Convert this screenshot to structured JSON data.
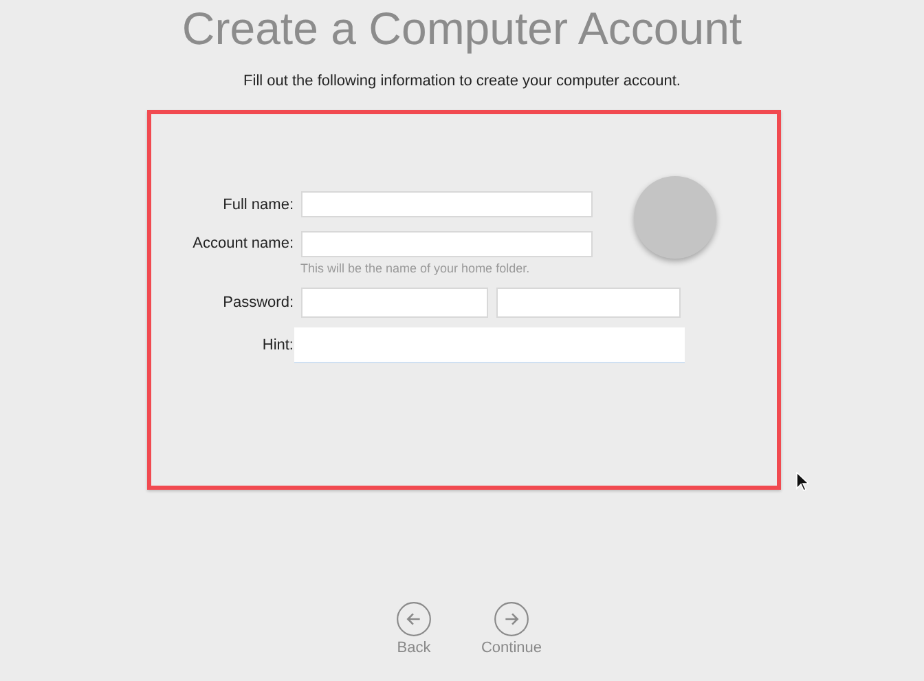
{
  "title": "Create a Computer Account",
  "subtitle": "Fill out the following information to create your computer account.",
  "form": {
    "fields": [
      {
        "label": "Full name:",
        "kind": "single"
      },
      {
        "label": "Account name:",
        "kind": "single",
        "note": "This will be the name of your home folder."
      },
      {
        "label": "Password:",
        "kind": "double"
      },
      {
        "label": "Hint:",
        "kind": "wide"
      }
    ]
  },
  "nav": [
    {
      "label": "Back",
      "kind": "back"
    },
    {
      "label": "Continue",
      "kind": "forward"
    }
  ]
}
